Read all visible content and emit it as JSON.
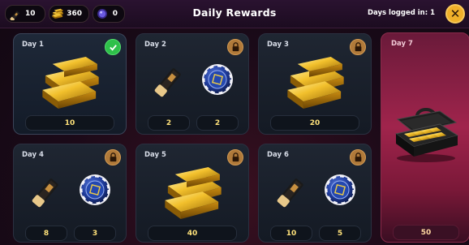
{
  "header": {
    "title": "Daily Rewards",
    "days_logged_in": "Days logged in: 1",
    "close_label": "✕",
    "resources": [
      {
        "icon": "ticket-icon",
        "value": "10"
      },
      {
        "icon": "gold-bar-icon",
        "value": "360"
      },
      {
        "icon": "gem-icon",
        "value": "0"
      }
    ]
  },
  "days": [
    {
      "label": "Day 1",
      "status": "claimed",
      "rewards": [
        {
          "icon": "gold-bars-icon",
          "value": "10"
        }
      ]
    },
    {
      "label": "Day 2",
      "status": "locked",
      "rewards": [
        {
          "icon": "ticket-icon",
          "value": "2"
        },
        {
          "icon": "poker-chip-icon",
          "value": "2"
        }
      ]
    },
    {
      "label": "Day 3",
      "status": "locked",
      "rewards": [
        {
          "icon": "gold-bars-icon",
          "value": "20"
        }
      ]
    },
    {
      "label": "Day 4",
      "status": "locked",
      "rewards": [
        {
          "icon": "ticket-icon",
          "value": "8"
        },
        {
          "icon": "poker-chip-icon",
          "value": "3"
        }
      ]
    },
    {
      "label": "Day 5",
      "status": "locked",
      "rewards": [
        {
          "icon": "gold-bars-icon",
          "value": "40"
        }
      ]
    },
    {
      "label": "Day 6",
      "status": "locked",
      "rewards": [
        {
          "icon": "ticket-icon",
          "value": "10"
        },
        {
          "icon": "poker-chip-icon",
          "value": "5"
        }
      ]
    },
    {
      "label": "Day 7",
      "status": "locked",
      "rewards": [
        {
          "icon": "gold-briefcase-icon",
          "value": "50"
        }
      ]
    }
  ],
  "colors": {
    "accent": "#f0b02a",
    "claimed": "#2ec04a",
    "lock": "#b07a3a",
    "value_text": "#ffe27a"
  }
}
